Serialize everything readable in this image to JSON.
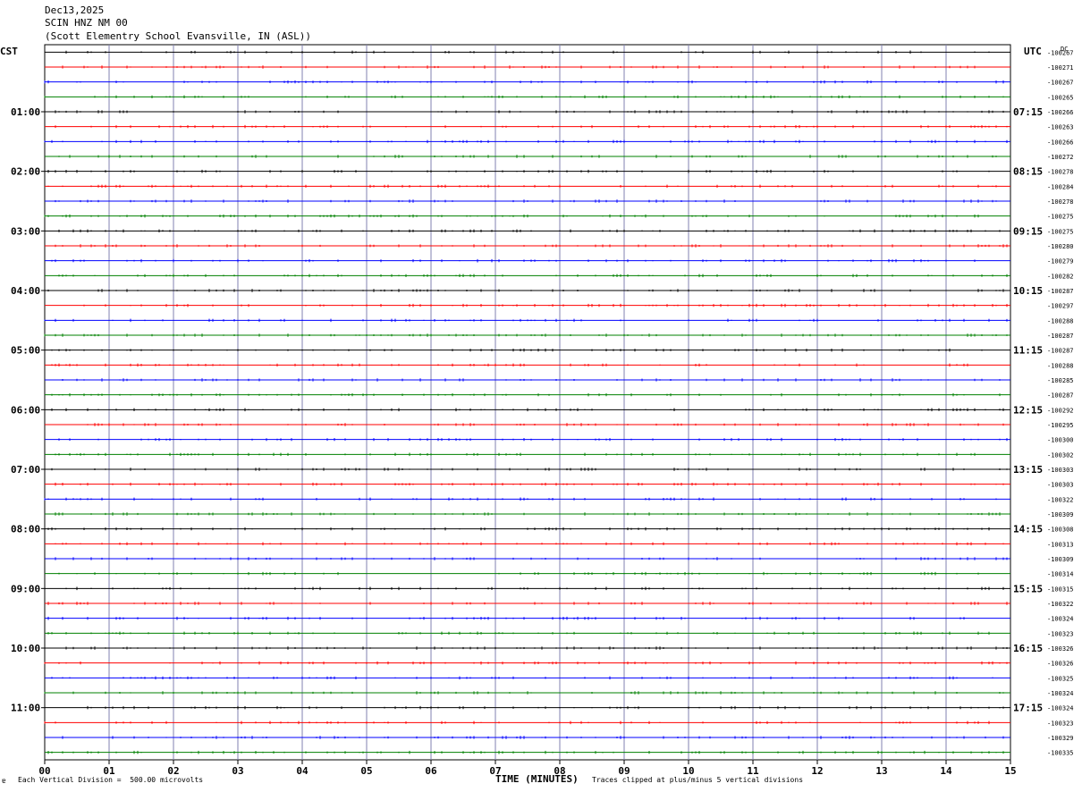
{
  "header": {
    "date": "Dec13,2025",
    "station": "SCIN HNZ NM 00",
    "location": "(Scott Elementry School Evansville, IN (ASL))"
  },
  "left_zone": "CST",
  "right_zone": "UTC",
  "dc_label": "DC",
  "footer": {
    "xaxis_title": "TIME (MINUTES)",
    "scale_note": "Each Vertical Division =  500.00 microvolts",
    "clip_note": "Traces clipped at plus/minus 5 vertical divisions",
    "corner_mark": "ɐ"
  },
  "chart_data": {
    "type": "line",
    "title": "SCIN HNZ NM 00",
    "xlabel": "TIME (MINUTES)",
    "xlim": [
      0,
      15
    ],
    "x_ticks": [
      "00",
      "01",
      "02",
      "03",
      "04",
      "05",
      "06",
      "07",
      "08",
      "09",
      "10",
      "11",
      "12",
      "13",
      "14",
      "15"
    ],
    "row_minutes": 15,
    "trace_colors": [
      "#000000",
      "#ff0000",
      "#0000ff",
      "#008000"
    ],
    "left_time_labels": [
      {
        "row": 4,
        "label": "01:00"
      },
      {
        "row": 8,
        "label": "02:00"
      },
      {
        "row": 12,
        "label": "03:00"
      },
      {
        "row": 16,
        "label": "04:00"
      },
      {
        "row": 20,
        "label": "05:00"
      },
      {
        "row": 24,
        "label": "06:00"
      },
      {
        "row": 28,
        "label": "07:00"
      },
      {
        "row": 32,
        "label": "08:00"
      },
      {
        "row": 36,
        "label": "09:00"
      },
      {
        "row": 40,
        "label": "10:00"
      },
      {
        "row": 44,
        "label": "11:00"
      }
    ],
    "right_time_labels": [
      {
        "row": 4,
        "label": "07:15"
      },
      {
        "row": 8,
        "label": "08:15"
      },
      {
        "row": 12,
        "label": "09:15"
      },
      {
        "row": 16,
        "label": "10:15"
      },
      {
        "row": 20,
        "label": "11:15"
      },
      {
        "row": 24,
        "label": "12:15"
      },
      {
        "row": 28,
        "label": "13:15"
      },
      {
        "row": 32,
        "label": "14:15"
      },
      {
        "row": 36,
        "label": "15:15"
      },
      {
        "row": 40,
        "label": "16:15"
      },
      {
        "row": 44,
        "label": "17:15"
      }
    ],
    "dc_offsets": [
      "-100267",
      "-100271",
      "-100267",
      "-100265",
      "-100266",
      "-100263",
      "-100266",
      "-100272",
      "-100278",
      "-100284",
      "-100278",
      "-100275",
      "-100275",
      "-100280",
      "-100279",
      "-100282",
      "-100287",
      "-100297",
      "-100288",
      "-100287",
      "-100287",
      "-100288",
      "-100285",
      "-100287",
      "-100292",
      "-100295",
      "-100300",
      "-100302",
      "-100303",
      "-100303",
      "-100322",
      "-100309",
      "-100308",
      "-100313",
      "-100309",
      "-100314",
      "-100315",
      "-100322",
      "-100324",
      "-100323",
      "-100326",
      "-100326",
      "-100325",
      "-100324",
      "-100324",
      "-100323",
      "-100329",
      "-100335"
    ]
  }
}
